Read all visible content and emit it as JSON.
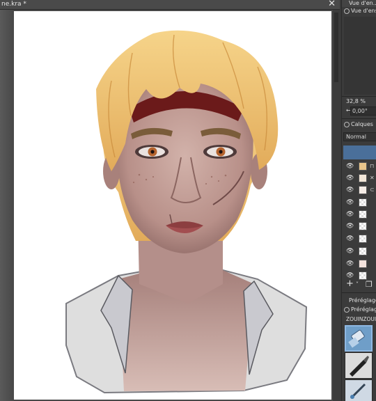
{
  "document": {
    "tab_title": "ne.kra *",
    "close_glyph": "✕"
  },
  "docker": {
    "overview_header": "Vue d'en...",
    "overview_tab": "Vue d'ens",
    "zoom_value": "32,8 %",
    "rotation_value": "0,00°",
    "layers_tab": "Calques",
    "blend_mode": "Normal",
    "presets_title": "Préréglages",
    "presets_tab": "Préréglag",
    "preset_tag": "ZOUINZOUIN",
    "add_glyph": "+",
    "layers": [
      {
        "thumb": "portrait"
      },
      {
        "thumb": "sketch"
      },
      {
        "thumb": "eyes"
      },
      {
        "thumb": "blank"
      },
      {
        "thumb": "lips"
      },
      {
        "thumb": "blank"
      },
      {
        "thumb": "lines"
      },
      {
        "thumb": "lines"
      },
      {
        "thumb": "dots"
      },
      {
        "thumb": "lines"
      }
    ]
  },
  "colors": {
    "accent": "#4a6f9a",
    "hair": "#f1c56f",
    "skin": "#c9a8a0",
    "headband": "#6b1a1a",
    "shirt": "#dcdcdc"
  },
  "icons": [
    "close-icon",
    "eye-icon",
    "add-icon",
    "duplicate-icon",
    "eraser-brush-icon",
    "pen-brush-icon",
    "pencil-brush-icon"
  ]
}
